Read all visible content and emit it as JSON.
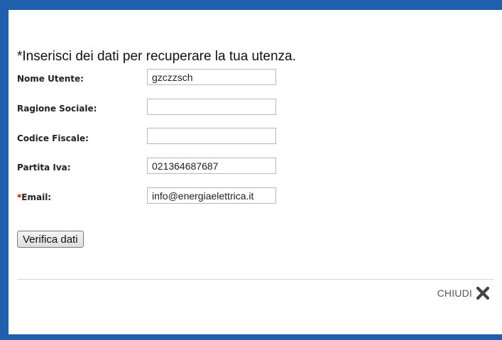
{
  "dialog": {
    "instruction": "*Inserisci dei dati per recuperare la tua utenza.",
    "fields": [
      {
        "label": "Nome Utente:",
        "value": "gzczzsch",
        "required": false
      },
      {
        "label": "Ragione Sociale:",
        "value": "",
        "required": false
      },
      {
        "label": "Codice Fiscale:",
        "value": "",
        "required": false
      },
      {
        "label": "Partita Iva:",
        "value": "021364687687",
        "required": false
      },
      {
        "label": "Email:",
        "required_marker": "*",
        "value": "info@energiaelettrica.it",
        "required": true
      }
    ],
    "verify_button_label": "Verifica dati",
    "close_label": "CHIUDI",
    "close_icon": "close-icon"
  },
  "colors": {
    "frame": "#1f5fae",
    "required_marker": "#cc0000"
  }
}
